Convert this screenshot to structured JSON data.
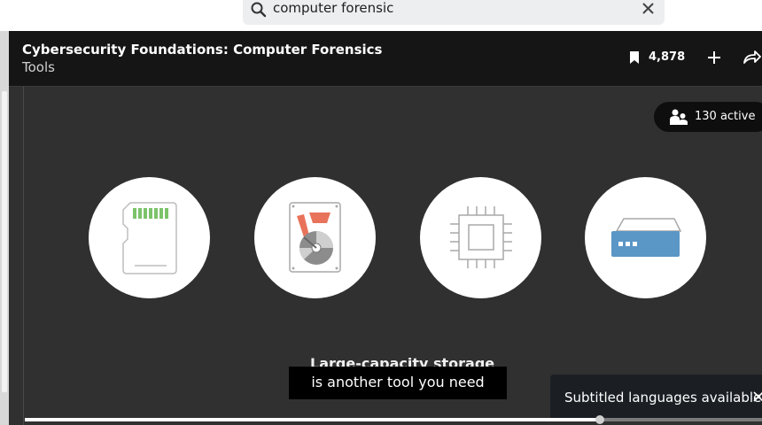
{
  "search": {
    "query": "computer forensic"
  },
  "header": {
    "course_title": "Cybersecurity Foundations: Computer Forensics",
    "chapter": "Tools",
    "bookmark_count": "4,878"
  },
  "viewers": {
    "label": "130 active"
  },
  "icons": [
    "sd-card-icon",
    "hard-drive-icon",
    "cpu-chip-icon",
    "network-storage-icon"
  ],
  "video": {
    "overlay_caption": "Large-capacity storage",
    "subtitle": "is another tool you need",
    "progress": 0.78
  },
  "toast": {
    "message": "Subtitled languages available"
  },
  "colors": {
    "player_bg": "#303030",
    "header_bg": "#151515",
    "accent_red": "#e8735a",
    "accent_blue": "#5a96c6",
    "accent_green": "#7cc36a"
  }
}
